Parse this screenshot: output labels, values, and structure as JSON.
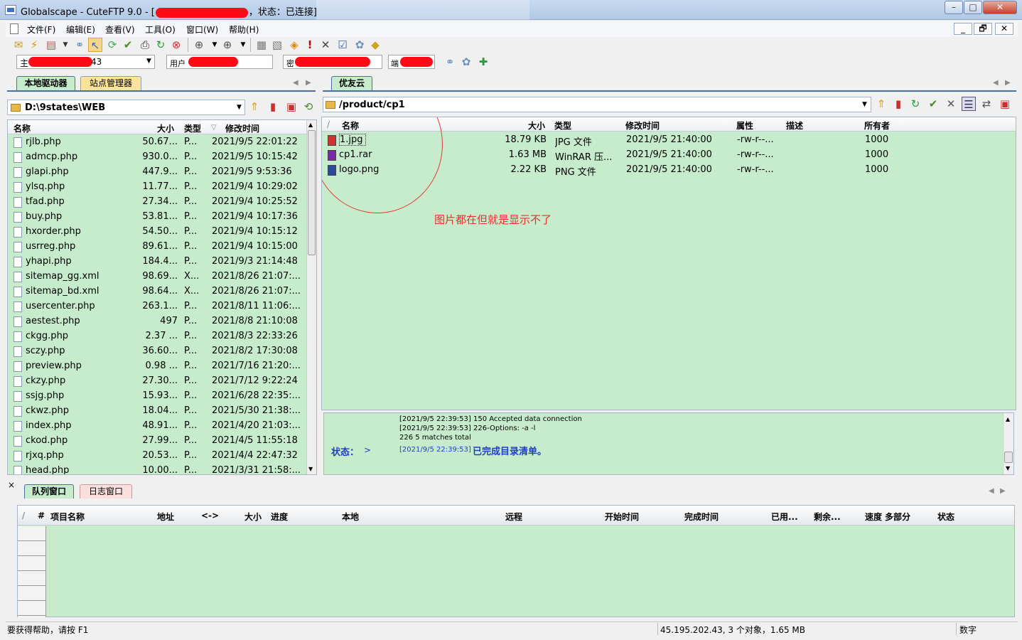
{
  "window": {
    "title": "Globalscape - CuteFTP 9.0 - [",
    "title_status": "，状态：已连接]",
    "controls": {
      "minimize": "–",
      "maximize": "□",
      "close": "✕"
    }
  },
  "menu": {
    "items": [
      "文件(F)",
      "编辑(E)",
      "查看(V)",
      "工具(O)",
      "窗口(W)",
      "帮助(H)"
    ],
    "mdi": {
      "minimize": "_",
      "restore": "🗗",
      "close": "✕"
    }
  },
  "quickconnect": {
    "host_prefix": "主",
    "host_suffix": "43",
    "user_label": "用户",
    "pass_label": "密",
    "port_label": "端"
  },
  "local": {
    "tabs": [
      "本地驱动器",
      "站点管理器"
    ],
    "path": "D:\\9states\\WEB",
    "columns": {
      "name": "名称",
      "size": "大小",
      "type": "类型",
      "modified": "修改时间"
    },
    "files": [
      {
        "name": "rjlb.php",
        "size": "50.67...",
        "type": "P...",
        "modified": "2021/9/5 22:01:22"
      },
      {
        "name": "admcp.php",
        "size": "930.0...",
        "type": "P...",
        "modified": "2021/9/5 10:15:42"
      },
      {
        "name": "glapi.php",
        "size": "447.9...",
        "type": "P...",
        "modified": "2021/9/5 9:53:36"
      },
      {
        "name": "ylsq.php",
        "size": "11.77...",
        "type": "P...",
        "modified": "2021/9/4 10:29:02"
      },
      {
        "name": "tfad.php",
        "size": "27.34...",
        "type": "P...",
        "modified": "2021/9/4 10:25:52"
      },
      {
        "name": "buy.php",
        "size": "53.81...",
        "type": "P...",
        "modified": "2021/9/4 10:17:36"
      },
      {
        "name": "hxorder.php",
        "size": "54.50...",
        "type": "P...",
        "modified": "2021/9/4 10:15:12"
      },
      {
        "name": "usrreg.php",
        "size": "89.61...",
        "type": "P...",
        "modified": "2021/9/4 10:15:00"
      },
      {
        "name": "yhapi.php",
        "size": "184.4...",
        "type": "P...",
        "modified": "2021/9/3 21:14:48"
      },
      {
        "name": "sitemap_gg.xml",
        "size": "98.69...",
        "type": "X...",
        "modified": "2021/8/26 21:07:..."
      },
      {
        "name": "sitemap_bd.xml",
        "size": "98.64...",
        "type": "X...",
        "modified": "2021/8/26 21:07:..."
      },
      {
        "name": "usercenter.php",
        "size": "263.1...",
        "type": "P...",
        "modified": "2021/8/11 11:06:..."
      },
      {
        "name": "aestest.php",
        "size": "497",
        "type": "P...",
        "modified": "2021/8/8 21:10:08"
      },
      {
        "name": "ckgg.php",
        "size": "2.37 ...",
        "type": "P...",
        "modified": "2021/8/3 22:33:26"
      },
      {
        "name": "sczy.php",
        "size": "36.60...",
        "type": "P...",
        "modified": "2021/8/2 17:30:08"
      },
      {
        "name": "preview.php",
        "size": "0.98 ...",
        "type": "P...",
        "modified": "2021/7/16 21:20:..."
      },
      {
        "name": "ckzy.php",
        "size": "27.30...",
        "type": "P...",
        "modified": "2021/7/12 9:22:24"
      },
      {
        "name": "ssjg.php",
        "size": "15.93...",
        "type": "P...",
        "modified": "2021/6/28 22:35:..."
      },
      {
        "name": "ckwz.php",
        "size": "18.04...",
        "type": "P...",
        "modified": "2021/5/30 21:38:..."
      },
      {
        "name": "index.php",
        "size": "48.91...",
        "type": "P...",
        "modified": "2021/4/20 21:03:..."
      },
      {
        "name": "ckod.php",
        "size": "27.99...",
        "type": "P...",
        "modified": "2021/4/5 11:55:18"
      },
      {
        "name": "rjxq.php",
        "size": "20.53...",
        "type": "P...",
        "modified": "2021/4/4 22:47:32"
      },
      {
        "name": "head.php",
        "size": "10.00...",
        "type": "P...",
        "modified": "2021/3/31 21:58:..."
      }
    ]
  },
  "remote": {
    "tab": "优友云",
    "path": "/product/cp1",
    "columns": {
      "name": "名称",
      "size": "大小",
      "type": "类型",
      "modified": "修改时间",
      "attrs": "属性",
      "desc": "描述",
      "owner": "所有者"
    },
    "files": [
      {
        "name": "1.jpg",
        "size": "18.79 KB",
        "type": "JPG 文件",
        "modified": "2021/9/5 21:40:00",
        "attrs": "-rw-r--...",
        "owner": "1000"
      },
      {
        "name": "cp1.rar",
        "size": "1.63 MB",
        "type": "WinRAR 压...",
        "modified": "2021/9/5 21:40:00",
        "attrs": "-rw-r--...",
        "owner": "1000"
      },
      {
        "name": "logo.png",
        "size": "2.22 KB",
        "type": "PNG 文件",
        "modified": "2021/9/5 21:40:00",
        "attrs": "-rw-r--...",
        "owner": "1000"
      }
    ],
    "annotation": "图片都在但就是显示不了"
  },
  "log": {
    "lines": [
      "[2021/9/5 22:39:53] 150 Accepted data connection",
      "[2021/9/5 22:39:53] 226-Options: -a -l",
      "226 5 matches total"
    ],
    "status_label": "状态：",
    "status_arrow": ">",
    "status_time": "[2021/9/5 22:39:53]",
    "status_msg": "已完成目录清单。"
  },
  "queue": {
    "tabs": [
      "队列窗口",
      "日志窗口"
    ],
    "close": "×",
    "columns": {
      "sort": "/",
      "num": "#",
      "item": "项目名称",
      "addr": "地址",
      "dir": "<->",
      "size": "大小",
      "progress": "进度",
      "local": "本地",
      "remote": "远程",
      "start": "开始时间",
      "finish": "完成时间",
      "elapsed": "已用...",
      "remaining": "剩余...",
      "speed": "速度",
      "multipart": "多部分",
      "status": "状态"
    }
  },
  "statusbar": {
    "help": "要获得帮助，请按 F1",
    "info": "45.195.202.43, 3 个对象，1.65 MB",
    "numlock": "数字"
  },
  "colors": {
    "pane_bg": "#c6eccb",
    "annotation": "#e8302e",
    "status_blue": "#1f3fc8"
  }
}
